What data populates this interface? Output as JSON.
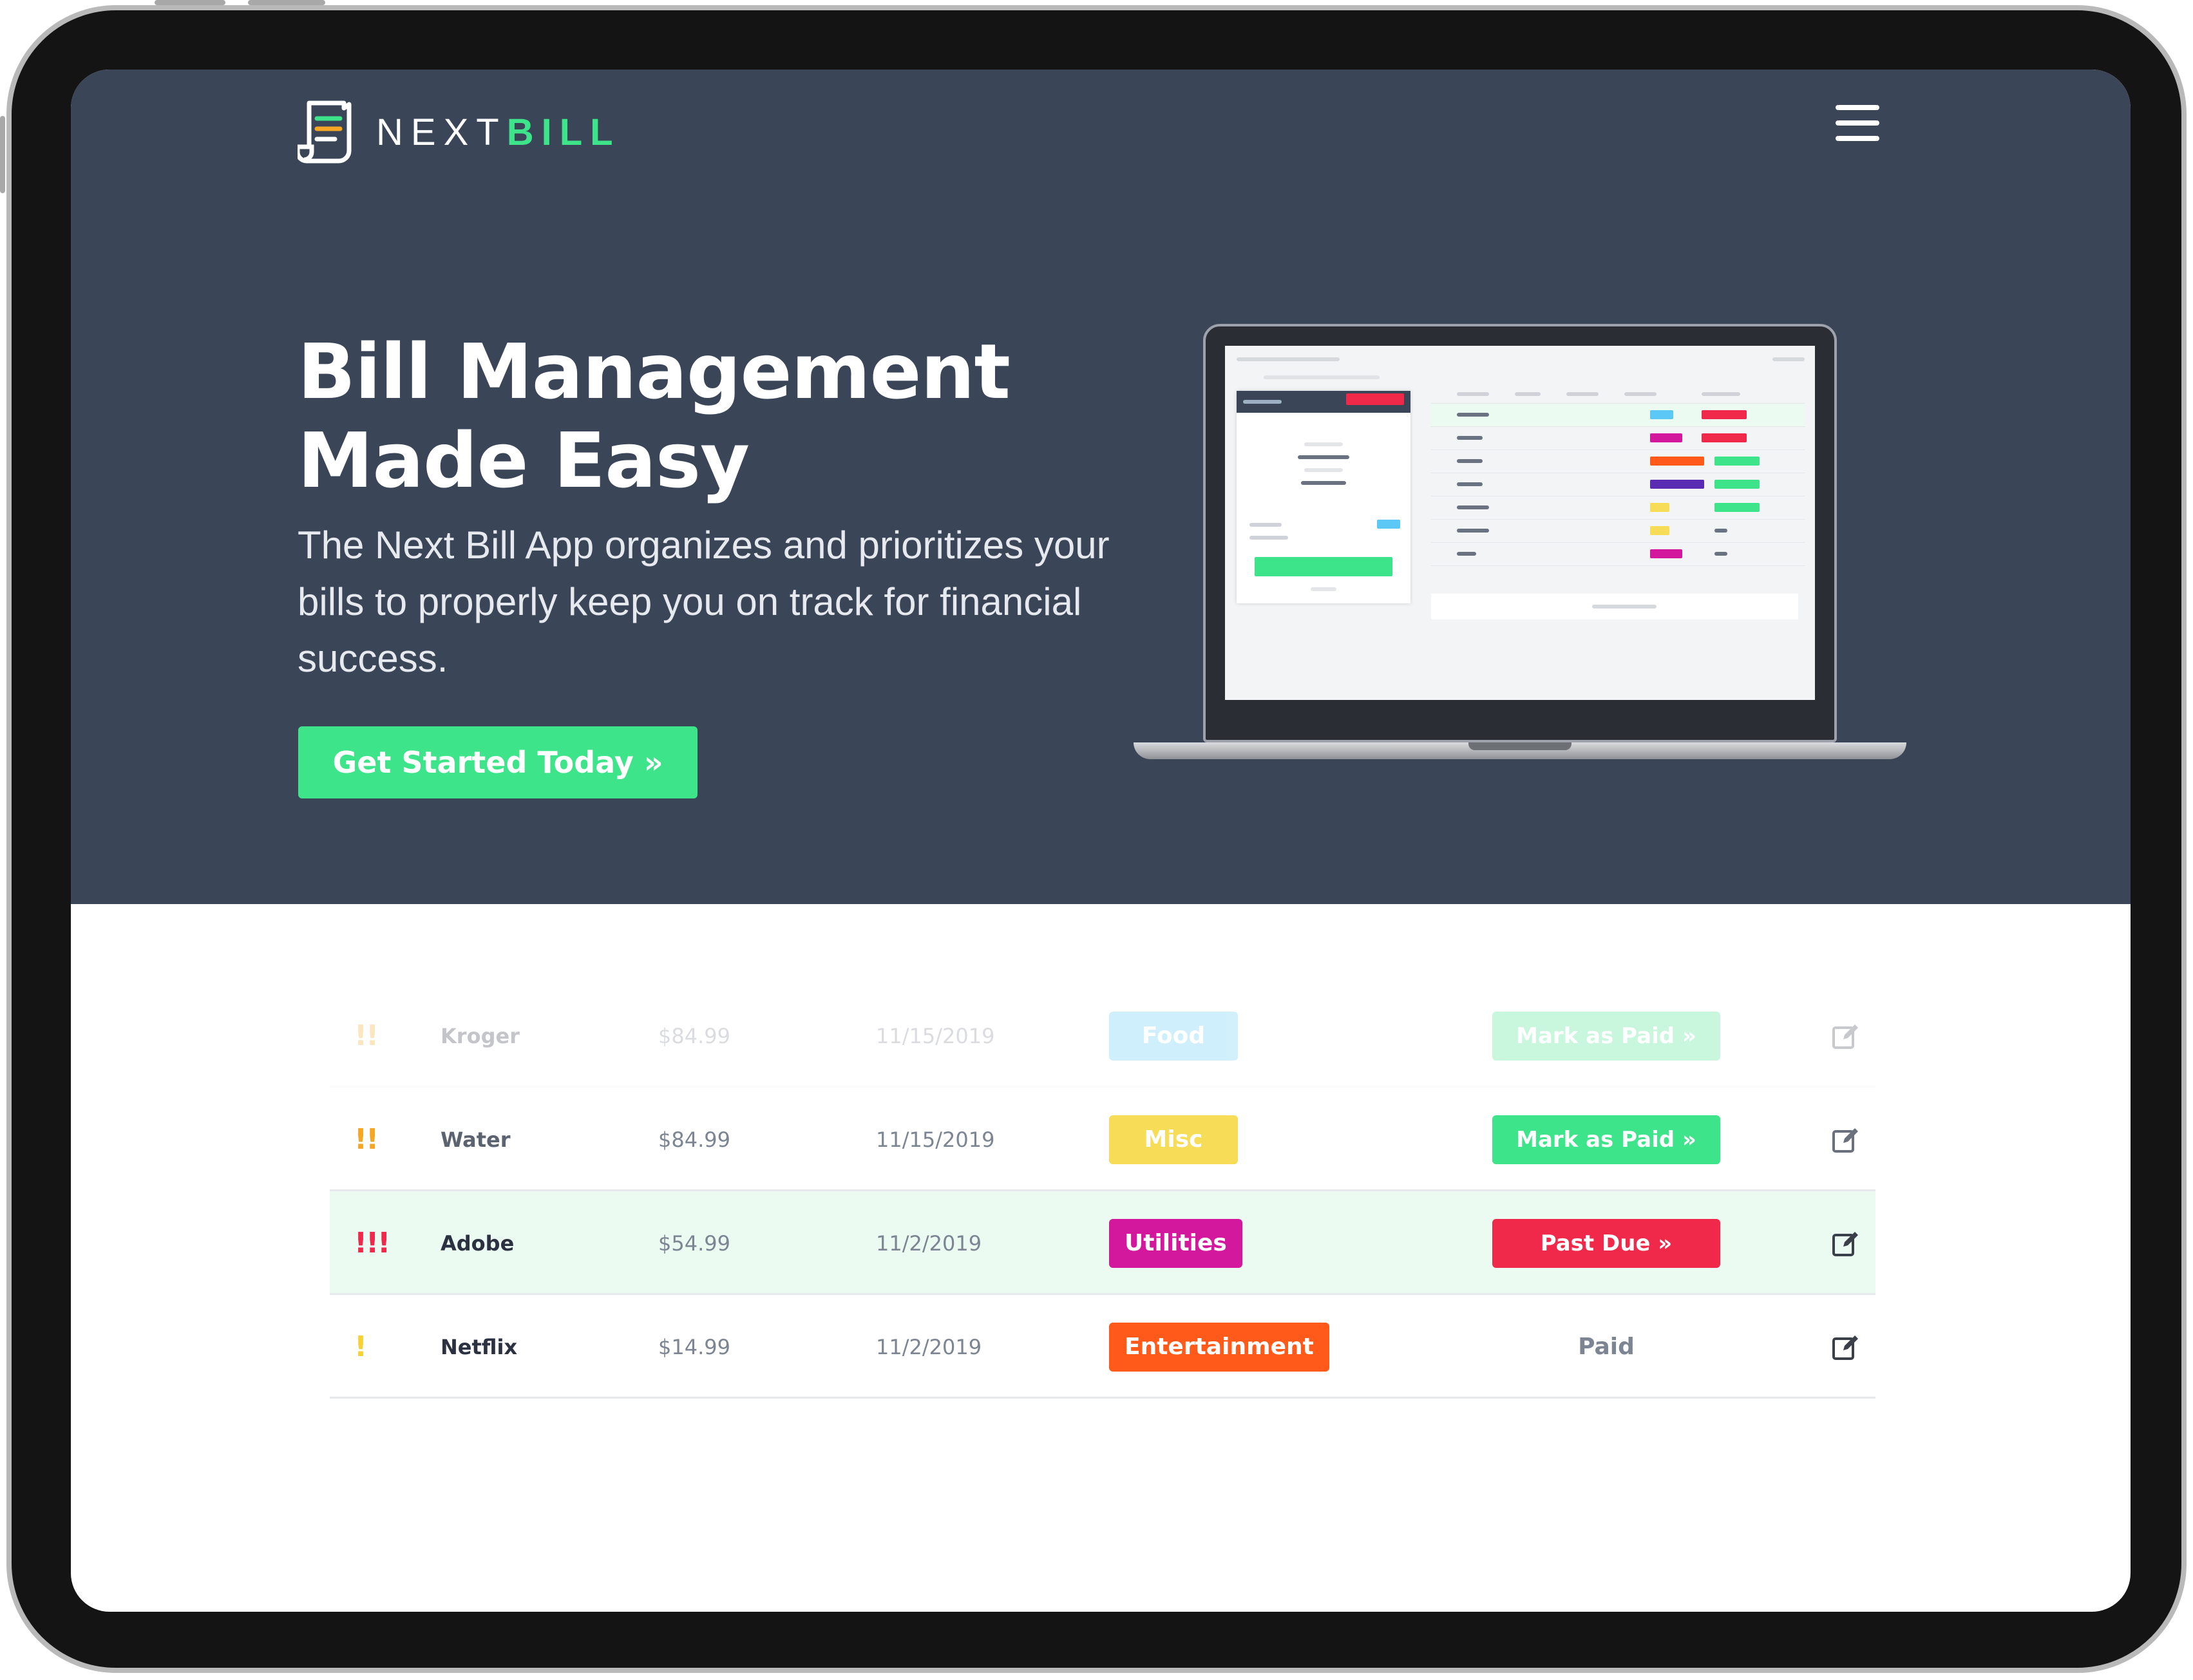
{
  "brand": {
    "name_light": "NEXT",
    "name_bold": "BILL",
    "accent": "#3de48a",
    "hero_bg": "#3a4557"
  },
  "hero": {
    "title_line1": "Bill Management",
    "title_line2": "Made Easy",
    "subtitle": "The Next Bill App organizes and prioritizes your bills to properly keep you on track for financial success.",
    "cta_label": "Get Started Today »"
  },
  "icons": {
    "logo": "receipt-icon",
    "menu": "hamburger-menu-icon",
    "edit": "edit-icon"
  },
  "bills": [
    {
      "priority": "!!",
      "priority_color": "#f5a623",
      "name": "Kroger",
      "amount": "$84.99",
      "due_date": "11/15/2019",
      "category": "Food",
      "category_color": "#5bc8f5",
      "status": "Mark as Paid »",
      "status_type": "button",
      "status_color": "#3de48a"
    },
    {
      "priority": "!!",
      "priority_color": "#f5a623",
      "name": "Water",
      "amount": "$84.99",
      "due_date": "11/15/2019",
      "category": "Misc",
      "category_color": "#f7dc57",
      "status": "Mark as Paid »",
      "status_type": "button",
      "status_color": "#3de48a"
    },
    {
      "priority": "!!!",
      "priority_color": "#f0294a",
      "name": "Adobe",
      "amount": "$54.99",
      "due_date": "11/2/2019",
      "category": "Utilities",
      "category_color": "#d4189e",
      "status": "Past Due »",
      "status_type": "button",
      "status_color": "#f0294a"
    },
    {
      "priority": "!",
      "priority_color": "#f7d236",
      "name": "Netflix",
      "amount": "$14.99",
      "due_date": "11/2/2019",
      "category": "Entertainment",
      "category_color": "#ff5a1a",
      "status": "Paid",
      "status_type": "text",
      "status_color": "#7d8592"
    }
  ]
}
